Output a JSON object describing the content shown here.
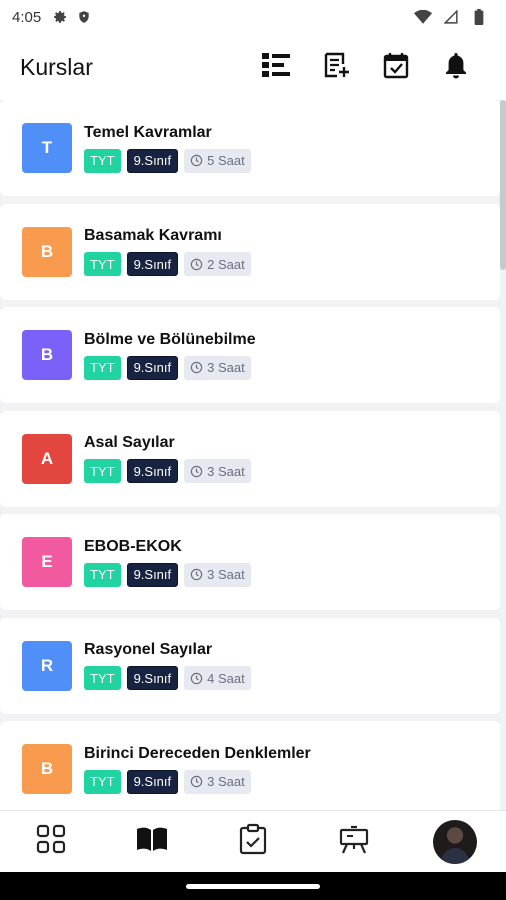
{
  "status_bar": {
    "time": "4:05",
    "icons": [
      "gear-icon",
      "shield-icon",
      "wifi-icon",
      "signal-icon",
      "battery-icon"
    ]
  },
  "app_bar": {
    "title": "Kurslar",
    "actions": [
      "list-filter-icon",
      "add-note-icon",
      "calendar-check-icon",
      "bell-icon"
    ]
  },
  "courses": [
    {
      "initial": "T",
      "title": "Temel Kavramlar",
      "exam": "TYT",
      "grade": "9.Sınıf",
      "hours": "5 Saat",
      "color": "#4f8ff7"
    },
    {
      "initial": "B",
      "title": "Basamak Kavramı",
      "exam": "TYT",
      "grade": "9.Sınıf",
      "hours": "2 Saat",
      "color": "#f99b4e"
    },
    {
      "initial": "B",
      "title": "Bölme ve Bölünebilme",
      "exam": "TYT",
      "grade": "9.Sınıf",
      "hours": "3 Saat",
      "color": "#7b61f7"
    },
    {
      "initial": "A",
      "title": "Asal Sayılar",
      "exam": "TYT",
      "grade": "9.Sınıf",
      "hours": "3 Saat",
      "color": "#e2463f"
    },
    {
      "initial": "E",
      "title": "EBOB-EKOK",
      "exam": "TYT",
      "grade": "9.Sınıf",
      "hours": "3 Saat",
      "color": "#f25aa0"
    },
    {
      "initial": "R",
      "title": "Rasyonel Sayılar",
      "exam": "TYT",
      "grade": "9.Sınıf",
      "hours": "4 Saat",
      "color": "#4f8ff7"
    },
    {
      "initial": "B",
      "title": "Birinci Dereceden Denklemler",
      "exam": "TYT",
      "grade": "9.Sınıf",
      "hours": "3 Saat",
      "color": "#f99b4e"
    }
  ],
  "bottom_nav": {
    "items": [
      "dashboard-icon",
      "book-icon",
      "clipboard-check-icon",
      "presentation-board-icon",
      "profile-avatar"
    ],
    "active": "book-icon"
  }
}
